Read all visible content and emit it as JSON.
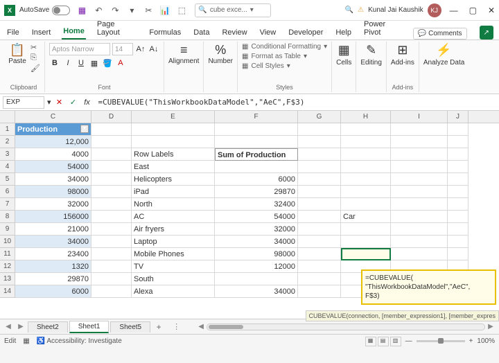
{
  "title": {
    "autosave": "AutoSave",
    "filename": "cube exce...",
    "username": "Kunal Jai Kaushik",
    "initials": "KJ"
  },
  "tabs": {
    "file": "File",
    "insert": "Insert",
    "home": "Home",
    "pagelayout": "Page Layout",
    "formulas": "Formulas",
    "data": "Data",
    "review": "Review",
    "view": "View",
    "developer": "Developer",
    "help": "Help",
    "powerpivot": "Power Pivot",
    "comments": "Comments"
  },
  "ribbon": {
    "clipboard": "Clipboard",
    "paste": "Paste",
    "font": "Font",
    "fontname": "Aptos Narrow",
    "fontsize": "14",
    "alignment": "Alignment",
    "number": "Number",
    "styles": "Styles",
    "cf": "Conditional Formatting",
    "fat": "Format as Table",
    "cs": "Cell Styles",
    "cells": "Cells",
    "editing": "Editing",
    "addins": "Add-ins",
    "analyze": "Analyze Data"
  },
  "formulabar": {
    "namebox": "EXP",
    "formula": "=CUBEVALUE(\"ThisWorkbookDataModel\",\"AeC\",F$3)"
  },
  "cols": {
    "C": "C",
    "D": "D",
    "E": "E",
    "F": "F",
    "G": "G",
    "H": "H",
    "I": "I",
    "J": "J"
  },
  "colw": {
    "C": 110,
    "D": 58,
    "E": 120,
    "F": 120,
    "G": 62,
    "H": 72,
    "I": 82,
    "J": 30
  },
  "data": {
    "header": "Production",
    "c": [
      "12,000",
      "4000",
      "54000",
      "34000",
      "98000",
      "32000",
      "156000",
      "21000",
      "34000",
      "23400",
      "1320",
      "29870",
      "6000"
    ],
    "e": [
      "",
      "Row Labels",
      "East",
      "   Helicopters",
      "   iPad",
      "North",
      "   AC",
      "   Air fryers",
      "   Laptop",
      "   Mobile Phones",
      "   TV",
      "South",
      "   Alexa"
    ],
    "f": [
      "",
      "Sum of Production",
      "",
      "6000",
      "29870",
      "32400",
      "54000",
      "32000",
      "34000",
      "98000",
      "12000",
      "",
      "34000"
    ],
    "h8": "Car"
  },
  "popup": {
    "line1": "=CUBEVALUE(",
    "line2": "\"ThisWorkbookDataModel\",\"AeC\",",
    "line3": "F$3)",
    "syntax": "CUBEVALUE(connection, [member_expression1], [member_expres"
  },
  "sheets": {
    "s2": "Sheet2",
    "s1": "Sheet1",
    "s5": "Sheet5"
  },
  "status": {
    "mode": "Edit",
    "access": "Accessibility: Investigate",
    "zoom": "100%"
  }
}
